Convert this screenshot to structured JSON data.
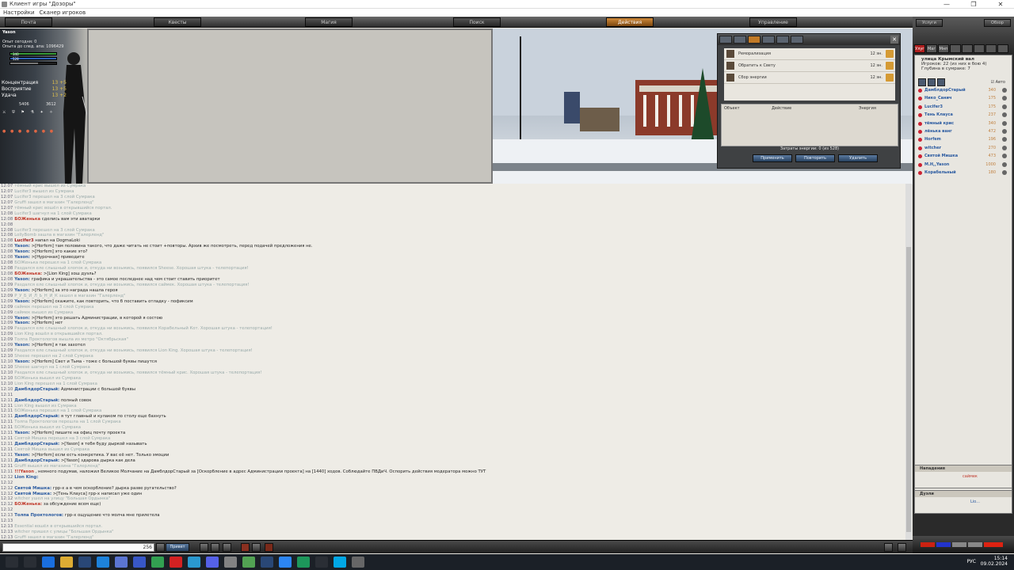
{
  "window": {
    "title": "Клиент игры \"Дозоры\"",
    "menu": [
      "Настройки",
      "Сканер игроков"
    ]
  },
  "nav": [
    "Почта",
    "Квесты",
    "Магия",
    "Поиск",
    "Действия",
    "Управление"
  ],
  "character": {
    "name": "Yason",
    "exp_today": "Опыт сегодня: 0",
    "exp_next": "Опыта до след. апа: 1096429",
    "hp": "340",
    "mp": "528",
    "hp_max": "340",
    "mp_max": "528",
    "attrs": [
      {
        "label": "Концентрация",
        "value": "13",
        "bonus": "+5"
      },
      {
        "label": "Восприятие",
        "value": "13",
        "bonus": "+5"
      },
      {
        "label": "Удача",
        "value": "13",
        "bonus": "+2"
      }
    ],
    "stat_a": "5406",
    "stat_b": "3612"
  },
  "spells": {
    "rows": [
      {
        "name": "Реморализация",
        "cost": "12 эн."
      },
      {
        "name": "Обратить к Свету",
        "cost": "12 эн."
      },
      {
        "name": "Сбор энергии",
        "cost": "12 эн."
      }
    ],
    "table_headers": [
      "Объект",
      "Действие",
      "Энергия"
    ],
    "energy": "Затраты энергии: 0 (из 528)",
    "buttons": [
      "Применить",
      "Повторить",
      "Удалить"
    ]
  },
  "chat": [
    {
      "t": "12:07",
      "k": "sys",
      "x": "тёмный крис вышел из Сумрака"
    },
    {
      "t": "12:07",
      "k": "sys",
      "x": "Lucifer3 вышел из Сумрака"
    },
    {
      "t": "12:07",
      "k": "sys",
      "x": "Lucifer3 перешел на 3 слой Сумрака"
    },
    {
      "t": "12:07",
      "k": "sys",
      "x": "Gruffi зашел в магазин \"Галерленд\""
    },
    {
      "t": "12:07",
      "k": "sys",
      "x": "тёмный крис вошёл в открывшийся портал."
    },
    {
      "t": "12:08",
      "k": "sys",
      "x": "Lucifer3 шагнул на 1 слой Сумрака"
    },
    {
      "t": "12:08",
      "k": "msg",
      "s": "БОЖенька",
      "c": "#c0392b",
      "x": "сделись вам эти аватарки"
    },
    {
      "t": "12:08",
      "k": "sys",
      "x": ""
    },
    {
      "t": "12:08",
      "k": "sys",
      "x": "Lucifer3 перешел на 3 слой Сумрака"
    },
    {
      "t": "12:08",
      "k": "sys",
      "x": "LollyBomb зашла в магазин \"Галерленд\""
    },
    {
      "t": "12:08",
      "k": "msg",
      "s": "Lucifer3",
      "c": "#a02020",
      "x": "напал на DogmaLoki"
    },
    {
      "t": "12:08",
      "k": "msg",
      "s": "Yason:",
      "c": "#2a5aa0",
      "x": ">[Horfem] там половина такого, что даже читать не стоит +повторы. Архив же посмотреть, перед подачей предложения не."
    },
    {
      "t": "12:08",
      "k": "msg",
      "s": "Yason:",
      "c": "#2a5aa0",
      "x": ">[Horfem] это какие это?"
    },
    {
      "t": "12:08",
      "k": "msg",
      "s": "Yason:",
      "c": "#2a5aa0",
      "x": ">[Нурочная] приводите"
    },
    {
      "t": "12:08",
      "k": "sys",
      "x": "БОЖенька перешел на 1 слой Сумрака"
    },
    {
      "t": "12:08",
      "k": "sys",
      "x": "Раздался еле слышный хлопок и, откуда ни возьмись, появился Sheese. Хорошая штука - телепортация!"
    },
    {
      "t": "12:08",
      "k": "msg",
      "s": "БОЖенька:",
      "c": "#c0392b",
      "x": ">[Lion King] хош дуэль?"
    },
    {
      "t": "12:08",
      "k": "msg",
      "s": "Yason:",
      "c": "#2a5aa0",
      "x": "графика и украшательства - это самое последнее над чем стоит ставить приоритет"
    },
    {
      "t": "12:09",
      "k": "sys",
      "x": "Раздался еле слышный хлопок и, откуда ни возьмись, появился саймек. Хорошая штука - телепортация!"
    },
    {
      "t": "12:09",
      "k": "msg",
      "s": "Yason:",
      "c": "#2a5aa0",
      "x": ">[Horfem] за это награда нашла героя"
    },
    {
      "t": "12:09",
      "k": "sys",
      "x": "Р_У_Б_И_Л_Ь_Н_И_К зашел в магазин \"Галерленд\""
    },
    {
      "t": "12:09",
      "k": "msg",
      "s": "Yason:",
      "c": "#2a5aa0",
      "x": ">[Horfem] скажите, как повторить, что б поставить отладку - пофиксим"
    },
    {
      "t": "12:09",
      "k": "sys",
      "x": "саймек перешел на 3 слой Сумрака"
    },
    {
      "t": "12:09",
      "k": "sys",
      "x": "саймек вышел из Сумрака"
    },
    {
      "t": "12:09",
      "k": "msg",
      "s": "Yason:",
      "c": "#2a5aa0",
      "x": ">[Horfem] это решать Администрации, в которой я состою"
    },
    {
      "t": "12:09",
      "k": "msg",
      "s": "Yason:",
      "c": "#2a5aa0",
      "x": ">[Horfem] нет"
    },
    {
      "t": "12:09",
      "k": "sys",
      "x": "Раздался еле слышный хлопок и, откуда ни возьмись, появился Корабельный Кот. Хорошая штука - телепортация!"
    },
    {
      "t": "12:09",
      "k": "sys",
      "x": "Lion King вошёл в открывшийся портал."
    },
    {
      "t": "12:09",
      "k": "sys",
      "x": "Толпа Проктологов вышла из метро \"Октябрьская\""
    },
    {
      "t": "12:09",
      "k": "msg",
      "s": "Yason:",
      "c": "#2a5aa0",
      "x": ">[Horfem] я так захотел"
    },
    {
      "t": "12:09",
      "k": "sys",
      "x": "Раздался еле слышный хлопок и, откуда ни возьмись, появился Lion King. Хорошая штука - телепортация!"
    },
    {
      "t": "12:10",
      "k": "sys",
      "x": "Sheese перешел на 2 слой Сумрака"
    },
    {
      "t": "12:10",
      "k": "msg",
      "s": "Yason:",
      "c": "#2a5aa0",
      "x": ">[Horfem] Свет и Тьма - тоже с большой буквы пишутся"
    },
    {
      "t": "12:10",
      "k": "sys",
      "x": "Sheese шагнул на 1 слой Сумрака"
    },
    {
      "t": "12:10",
      "k": "sys",
      "x": "Раздался еле слышный хлопок и, откуда ни возьмись, появился тёмный крис. Хорошая штука - телепортация!"
    },
    {
      "t": "12:10",
      "k": "sys",
      "x": "БОЖенька вышел из Сумрака"
    },
    {
      "t": "12:10",
      "k": "sys",
      "x": "Lion King перешел на 1 слой Сумрака"
    },
    {
      "t": "12:10",
      "k": "msg",
      "s": "ДамблдорСтарый:",
      "c": "#2a5aa0",
      "x": "Администрации с большой буквы"
    },
    {
      "t": "12:11",
      "k": "sys",
      "x": ""
    },
    {
      "t": "12:11",
      "k": "msg",
      "s": "ДамблдорСтарый:",
      "c": "#2a5aa0",
      "x": "полный совок"
    },
    {
      "t": "12:11",
      "k": "sys",
      "x": "Lion King вышел из Сумрака"
    },
    {
      "t": "12:11",
      "k": "sys",
      "x": "БОЖенька перешел на 1 слой Сумрака"
    },
    {
      "t": "12:11",
      "k": "msg",
      "s": "ДамблдорСтарый:",
      "c": "#2a5aa0",
      "x": "я тут главный и кулаком по столу еще бахнуть"
    },
    {
      "t": "12:11",
      "k": "sys",
      "x": "Толпа Проктологов перешла на 1 слой Сумрака"
    },
    {
      "t": "12:11",
      "k": "sys",
      "x": "БОЖенька вышел из Сумрака"
    },
    {
      "t": "12:11",
      "k": "msg",
      "s": "Yason:",
      "c": "#2a5aa0",
      "x": ">[Horfem] пишите на офиц почту проекта"
    },
    {
      "t": "12:11",
      "k": "sys",
      "x": "Святой Мишка перешел на 3 слой Сумрака"
    },
    {
      "t": "12:11",
      "k": "msg",
      "s": "ДамблдорСтарый:",
      "c": "#2a5aa0",
      "x": ">[Yason] я тебя буду дыркой называть"
    },
    {
      "t": "12:11",
      "k": "sys",
      "x": "Святой Мишка вышел из Сумрака"
    },
    {
      "t": "12:11",
      "k": "msg",
      "s": "Yason:",
      "c": "#2a5aa0",
      "x": ">[Horfem] если есть конкретика. У вас её нет. Только эмоции"
    },
    {
      "t": "12:11",
      "k": "msg",
      "s": "ДамблдорСтарый:",
      "c": "#2a5aa0",
      "x": ">[Yason] здарова дырка как дела"
    },
    {
      "t": "12:11",
      "k": "sys",
      "x": "Gruffi вышел из магазина \"Галерленд\""
    },
    {
      "t": "12:11",
      "k": "msg",
      "s": "!!!Yason",
      "c": "#c0392b",
      "x": ", немного подумав, наложил Великое Молчание на ДамблдорСтарый за [Оскорбление в адрес Администрации проекта] на [1440] ходов. Соблюдайте ПВДиЧ. Оспорить действия модератора можно ТУТ"
    },
    {
      "t": "12:12",
      "k": "msg",
      "s": "Lion King:",
      "c": "#2a5aa0",
      "x": ""
    },
    {
      "t": "12:12",
      "k": "sys",
      "x": ""
    },
    {
      "t": "12:12",
      "k": "msg",
      "s": "Святой Мишка:",
      "c": "#2a5aa0",
      "x": "грр-х а в чем оскорбление? дырка разве ругательство?"
    },
    {
      "t": "12:12",
      "k": "msg",
      "s": "Святой Мишка:",
      "c": "#2a5aa0",
      "x": ">[Тень Клауса] грр-х написал уже один"
    },
    {
      "t": "12:12",
      "k": "sys",
      "x": "witcher ушел на улицу \"Большая Ордынка\""
    },
    {
      "t": "12:12",
      "k": "msg",
      "s": "БОЖенька:",
      "c": "#c0392b",
      "x": "за обсуждение всем еще)"
    },
    {
      "t": "12:12",
      "k": "sys",
      "x": ""
    },
    {
      "t": "12:13",
      "k": "msg",
      "s": "Толпа Проктологов:",
      "c": "#2a5aa0",
      "x": "грр-х  ощущение что молча мне прилетела"
    },
    {
      "t": "12:13",
      "k": "sys",
      "x": ""
    },
    {
      "t": "12:13",
      "k": "sys",
      "x": "Essential вошёл в открывшийся портал."
    },
    {
      "t": "12:13",
      "k": "sys",
      "x": "witcher пришел с улицы \"Большая Ордынка\""
    },
    {
      "t": "12:13",
      "k": "sys",
      "x": "Gruffi зашел в магазин \"Галерленд\""
    },
    {
      "t": "12:13",
      "k": "sys",
      "x": "Lucifer3 вышел из Сумрака"
    }
  ],
  "input": {
    "counter": "256",
    "send": "Привет"
  },
  "location": {
    "street": "улица Крымский вал",
    "players": "Игроков: 22 (из них в бою 4)",
    "depth": "Глубина в сумраке: 7",
    "auto": "Авто",
    "list": [
      {
        "name": "ДамблдорСтарый",
        "lv": "340"
      },
      {
        "name": "Нико_Санич",
        "lv": "175"
      },
      {
        "name": "Lucifer3",
        "lv": "175"
      },
      {
        "name": "Тень Клауса",
        "lv": "237"
      },
      {
        "name": "тёмный крис",
        "lv": "340"
      },
      {
        "name": "лёнька ванг",
        "lv": "472"
      },
      {
        "name": "Horfem",
        "lv": "196"
      },
      {
        "name": "witcher",
        "lv": "270"
      },
      {
        "name": "Святой Мишка",
        "lv": "473"
      },
      {
        "name": "M.H,,Yason",
        "lv": "1000"
      },
      {
        "name": "Корабельный",
        "lv": "180"
      }
    ]
  },
  "right_tabs": [
    "Улуг",
    "Маг",
    "Мнп"
  ],
  "right_top": [
    "Услуги",
    "Обзор"
  ],
  "attacks": {
    "title": "Нападения",
    "row": "саймек"
  },
  "duels": {
    "title": "Дуэли",
    "row": "Lio..."
  },
  "clock": {
    "time": "15:14",
    "date": "09.02.2024",
    "lang": "РУС"
  }
}
